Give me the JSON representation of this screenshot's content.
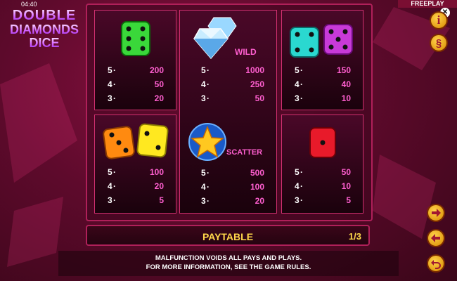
{
  "status": {
    "time": "04:40",
    "mode": "FREEPLAY"
  },
  "logo": {
    "line1": "DOUBLE",
    "line2": "DIAMONDS",
    "line3": "DICE"
  },
  "symbols": [
    {
      "id": "green-dice",
      "pays": [
        {
          "count": "5",
          "value": "200"
        },
        {
          "count": "4",
          "value": "50"
        },
        {
          "count": "3",
          "value": "20"
        }
      ]
    },
    {
      "id": "diamond-wild",
      "label": "WILD",
      "pays": [
        {
          "count": "5",
          "value": "1000"
        },
        {
          "count": "4",
          "value": "250"
        },
        {
          "count": "3",
          "value": "50"
        }
      ]
    },
    {
      "id": "cyan-purple-dice",
      "pays": [
        {
          "count": "5",
          "value": "150"
        },
        {
          "count": "4",
          "value": "40"
        },
        {
          "count": "3",
          "value": "10"
        }
      ]
    },
    {
      "id": "orange-yellow-dice",
      "pays": [
        {
          "count": "5",
          "value": "100"
        },
        {
          "count": "4",
          "value": "20"
        },
        {
          "count": "3",
          "value": "5"
        }
      ]
    },
    {
      "id": "star-scatter",
      "label": "SCATTER",
      "pays": [
        {
          "count": "5",
          "value": "500"
        },
        {
          "count": "4",
          "value": "100"
        },
        {
          "count": "3",
          "value": "20"
        }
      ]
    },
    {
      "id": "red-dice",
      "pays": [
        {
          "count": "5",
          "value": "50"
        },
        {
          "count": "4",
          "value": "10"
        },
        {
          "count": "3",
          "value": "5"
        }
      ]
    }
  ],
  "paytable": {
    "title": "PAYTABLE",
    "page": "1/3"
  },
  "footer": {
    "line1": "MALFUNCTION VOIDS ALL PAYS AND PLAYS.",
    "line2": "FOR MORE INFORMATION, SEE THE GAME RULES."
  },
  "icons": {
    "info": "info-icon",
    "dollar": "section-icon",
    "next": "arrow-right-icon",
    "prev": "arrow-left-icon",
    "back": "return-icon",
    "close": "close-icon"
  },
  "colors": {
    "accent": "#ffd84a",
    "pay_value": "#ff5fd0",
    "frame": "#b0205a"
  }
}
